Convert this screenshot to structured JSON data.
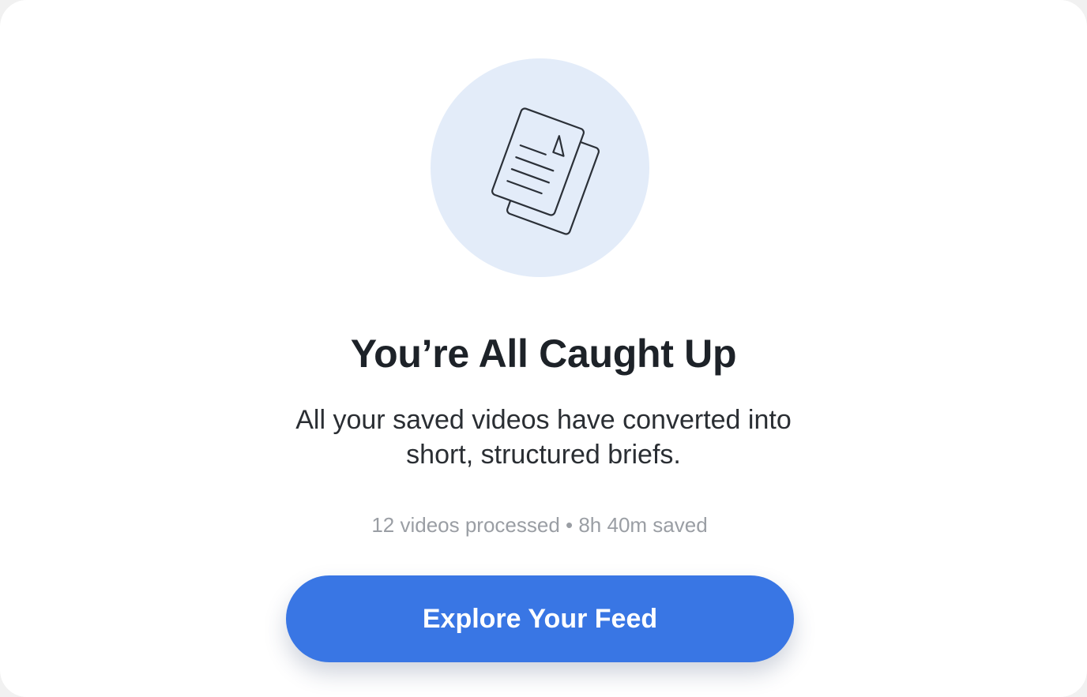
{
  "empty_state": {
    "illustration_icon": "stacked-documents-icon",
    "title": "You’re All Caught Up",
    "subtitle": "All your saved videos have converted into short, structured briefs.",
    "stats": "12 videos processed • 8h 40m saved",
    "cta_label": "Explore Your Feed"
  },
  "colors": {
    "accent": "#3976e4",
    "illustration_bg": "#e3ecf9",
    "title_text": "#1d2228",
    "muted_text": "#9a9ea4"
  }
}
